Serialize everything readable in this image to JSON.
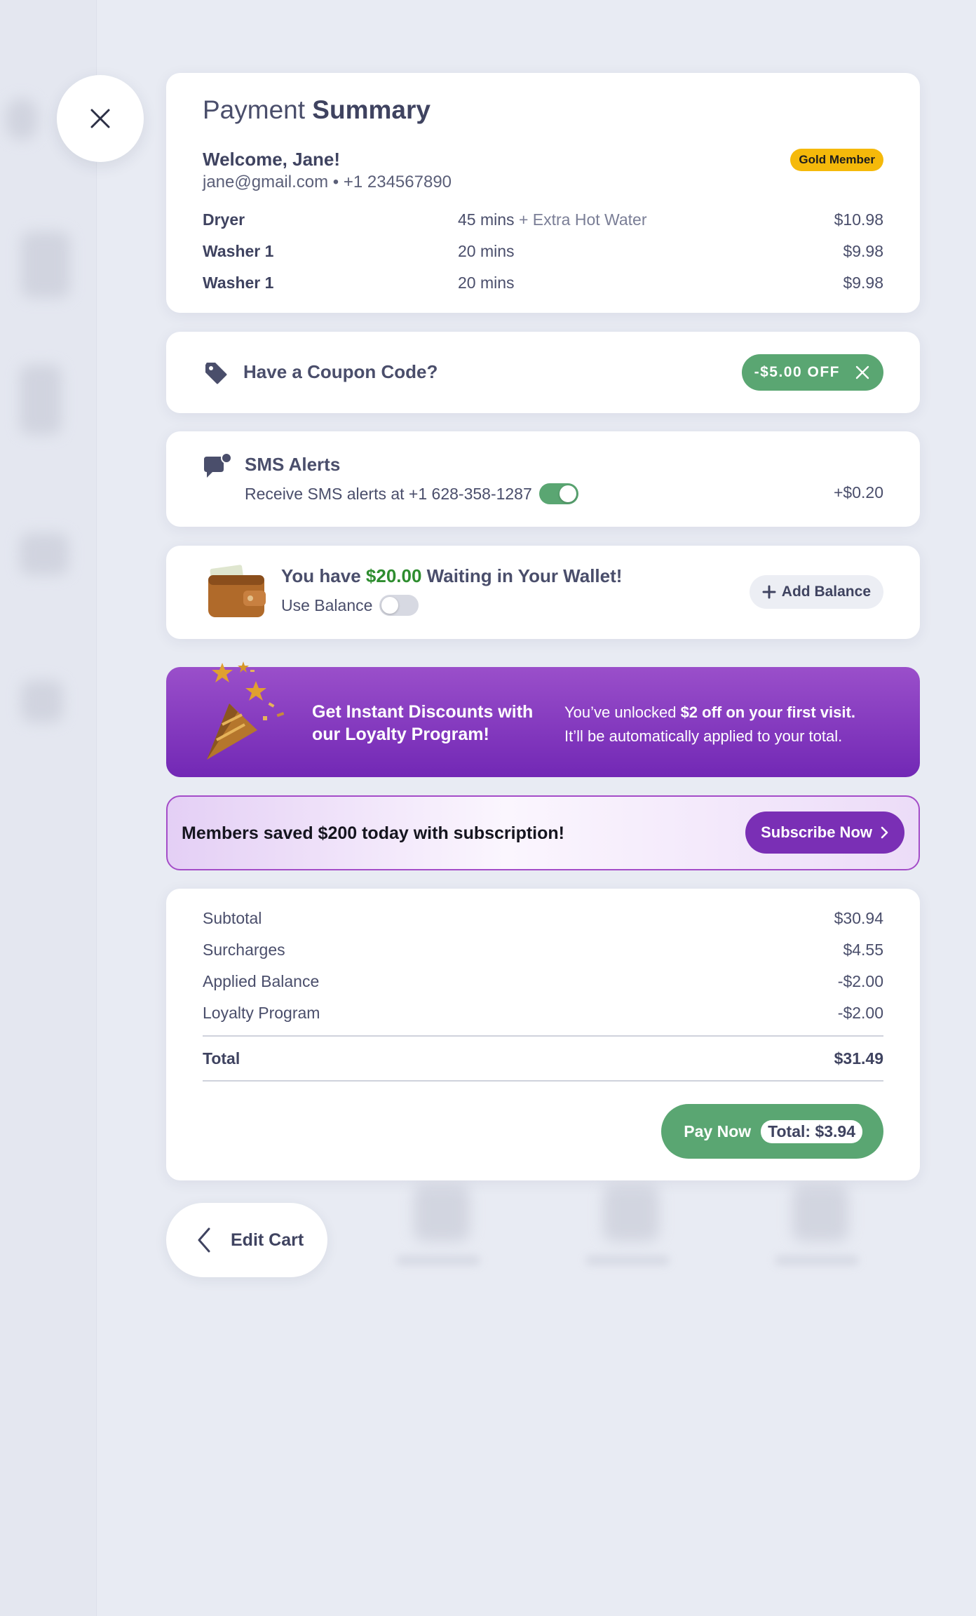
{
  "summary": {
    "title_light": "Payment",
    "title_bold": "Summary",
    "welcome": "Welcome, Jane!",
    "email": "jane@gmail.com",
    "phone": "+1 234567890",
    "badge": "Gold Member",
    "items": [
      {
        "name": "Dryer",
        "duration": "45 mins",
        "extra": "+ Extra Hot Water",
        "price": "$10.98"
      },
      {
        "name": "Washer 1",
        "duration": "20 mins",
        "extra": "",
        "price": "$9.98"
      },
      {
        "name": "Washer 1",
        "duration": "20 mins",
        "extra": "",
        "price": "$9.98"
      }
    ]
  },
  "coupon": {
    "label": "Have a Coupon Code?",
    "applied": "-$5.00 OFF",
    "icon": "tag-icon"
  },
  "sms": {
    "title": "SMS Alerts",
    "description": "Receive SMS alerts at +1 628-358-1287",
    "enabled": true,
    "price": "+$0.20"
  },
  "wallet": {
    "prefix": "You have",
    "amount": "$20.00",
    "suffix": "Waiting in Your Wallet!",
    "use_label": "Use Balance",
    "use_enabled": false,
    "add_label": "Add Balance"
  },
  "loyalty": {
    "headline": "Get Instant Discounts with our Loyalty Program!",
    "body_prefix": "You’ve unlocked",
    "body_bold": "$2 off on your first visit.",
    "body_suffix": "It’ll be automatically applied to your total."
  },
  "subscribe": {
    "text": "Members saved $200 today with subscription!",
    "button": "Subscribe Now"
  },
  "totals": {
    "subtotal_label": "Subtotal",
    "subtotal": "$30.94",
    "surcharges_label": "Surcharges",
    "surcharges": "$4.55",
    "applied_balance_label": "Applied Balance",
    "applied_balance": "-$2.00",
    "loyalty_label": "Loyalty Program",
    "loyalty": "-$2.00",
    "total_label": "Total",
    "total": "$31.49",
    "pay_label": "Pay Now",
    "pay_total": "Total: $3.94"
  },
  "edit_cart": "Edit Cart",
  "colors": {
    "accent_green": "#5aa672",
    "gold": "#f5b90a",
    "purple": "#7a2fb5",
    "text": "#3f4360"
  }
}
